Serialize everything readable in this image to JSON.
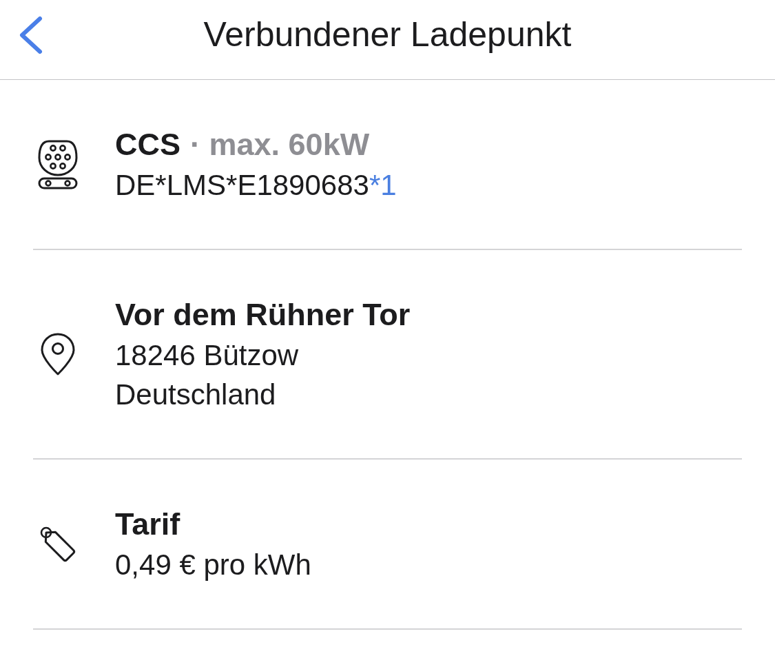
{
  "header": {
    "title": "Verbundener Ladepunkt"
  },
  "sections": [
    {
      "kind": "connector",
      "title": "CCS",
      "detail": "· max. 60kW",
      "lines": [
        {
          "text": "DE*LMS*E1890683",
          "suffix": "*1"
        }
      ]
    },
    {
      "kind": "location",
      "title": "Vor dem Rühner Tor",
      "lines": [
        {
          "text": "18246 Bützow"
        },
        {
          "text": "Deutschland"
        }
      ]
    },
    {
      "kind": "tariff",
      "title": "Tarif",
      "lines": [
        {
          "text": "0,49 € pro kWh"
        }
      ]
    }
  ]
}
